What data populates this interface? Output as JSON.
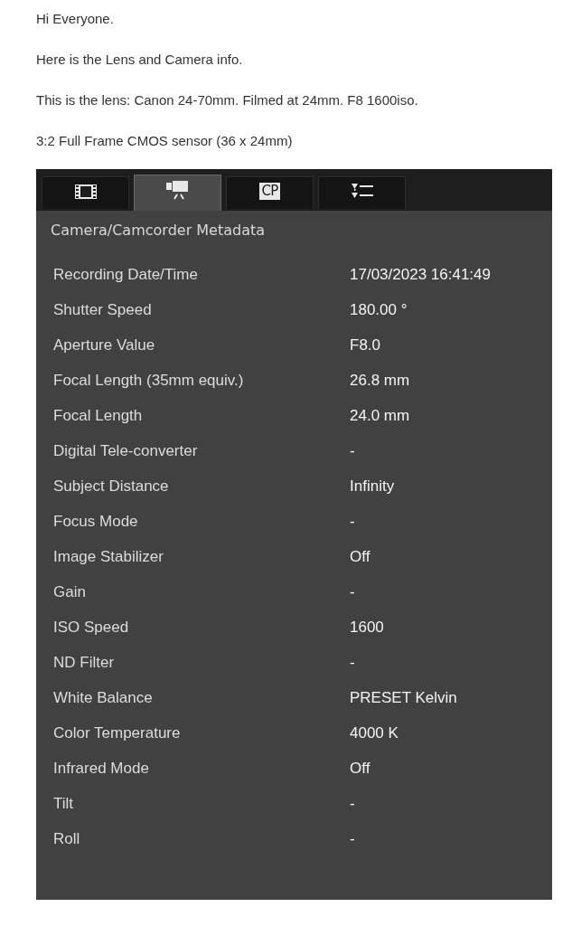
{
  "paragraphs": [
    "Hi Everyone.",
    "Here is the Lens and Camera info.",
    "This is the lens: Canon 24-70mm. Filmed at 24mm. F8 1600iso.",
    "3:2 Full Frame CMOS sensor (36 x 24mm)"
  ],
  "tabs": [
    {
      "kind": "film",
      "selected": false
    },
    {
      "kind": "camera",
      "selected": true
    },
    {
      "kind": "cp",
      "label": "CP",
      "selected": false
    },
    {
      "kind": "list",
      "selected": false
    }
  ],
  "panel": {
    "title": "Camera/Camcorder Metadata",
    "rows": [
      {
        "label": "Recording Date/Time",
        "value": "17/03/2023 16:41:49"
      },
      {
        "label": "Shutter Speed",
        "value": "180.00 °"
      },
      {
        "label": "Aperture Value",
        "value": "F8.0"
      },
      {
        "label": "Focal Length (35mm equiv.)",
        "value": "26.8 mm"
      },
      {
        "label": "Focal Length",
        "value": "24.0 mm"
      },
      {
        "label": "Digital Tele-converter",
        "value": "-"
      },
      {
        "label": "Subject Distance",
        "value": "Infinity"
      },
      {
        "label": "Focus Mode",
        "value": "-"
      },
      {
        "label": "Image Stabilizer",
        "value": "Off"
      },
      {
        "label": "Gain",
        "value": "-"
      },
      {
        "label": "ISO Speed",
        "value": "1600"
      },
      {
        "label": "ND Filter",
        "value": "-"
      },
      {
        "label": "White Balance",
        "value": "PRESET Kelvin"
      },
      {
        "label": "Color Temperature",
        "value": "4000 K"
      },
      {
        "label": "Infrared Mode",
        "value": "Off"
      },
      {
        "label": "Tilt",
        "value": "-"
      },
      {
        "label": "Roll",
        "value": "-"
      }
    ]
  }
}
